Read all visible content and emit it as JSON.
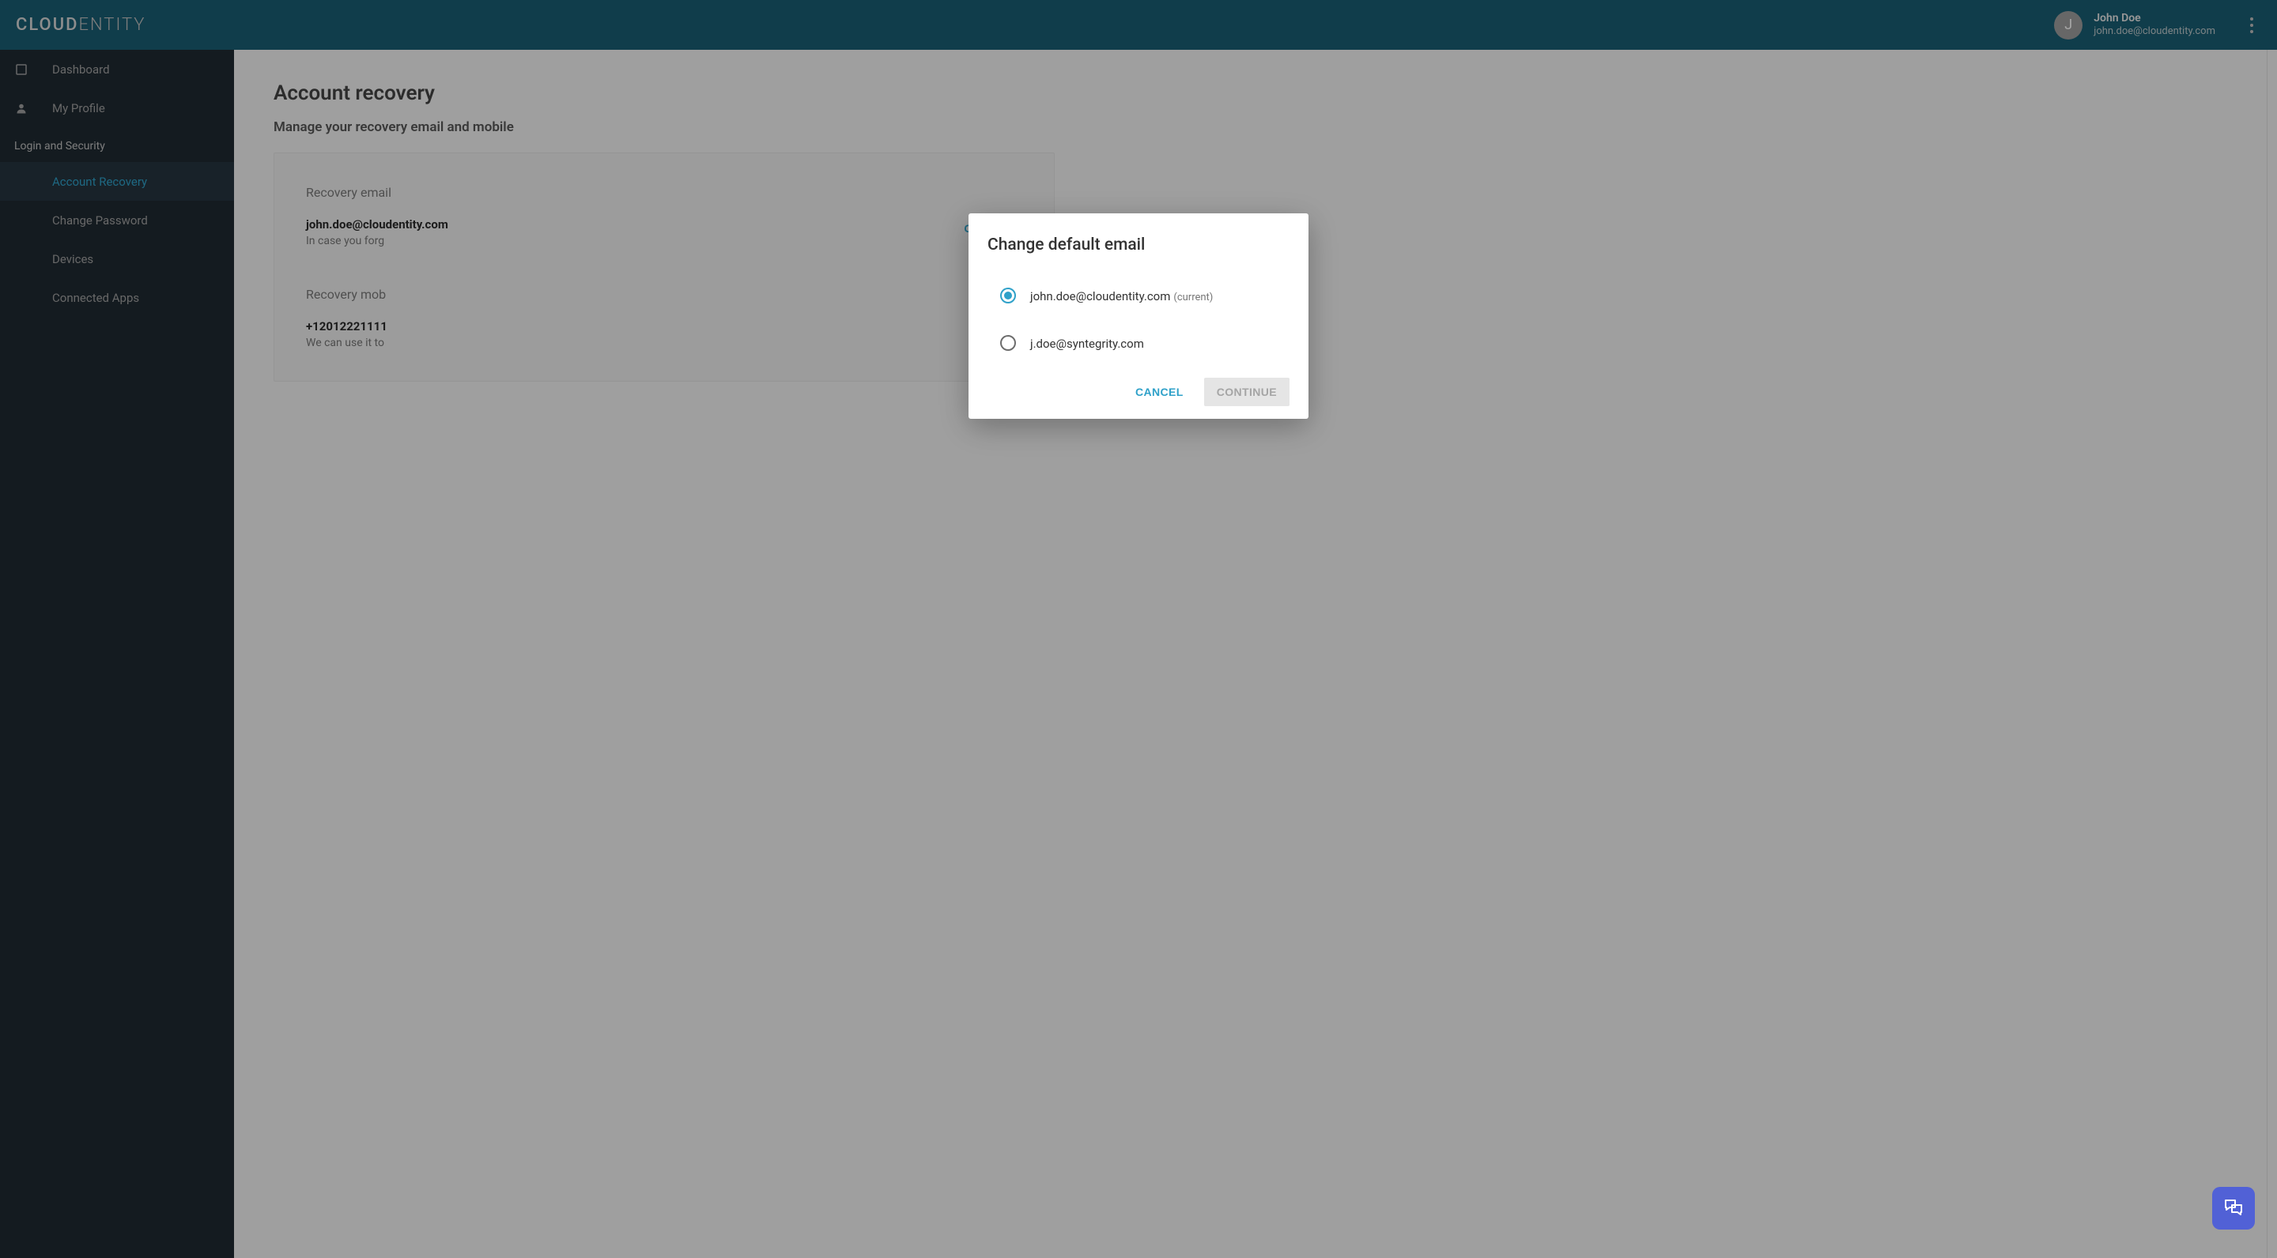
{
  "brand": {
    "part1": "CLOUD",
    "part2": "ENTITY"
  },
  "header": {
    "user_initial": "J",
    "user_name": "John Doe",
    "user_email": "john.doe@cloudentity.com"
  },
  "sidebar": {
    "items": {
      "dashboard": "Dashboard",
      "profile": "My Profile"
    },
    "section_title": "Login and Security",
    "subitems": {
      "account_recovery": "Account Recovery",
      "change_password": "Change Password",
      "devices": "Devices",
      "connected_apps": "Connected Apps"
    }
  },
  "main": {
    "title": "Account recovery",
    "subtitle": "Manage your recovery email and mobile",
    "section_email_label": "Recovery email",
    "email_value": "john.doe@cloudentity.com",
    "email_hint_partial": "In case you forg",
    "section_mobile_label": "Recovery mob",
    "mobile_value": "+12012221111",
    "mobile_hint_partial": "We can use it to",
    "change_label": "CHANGE"
  },
  "modal": {
    "title": "Change default email",
    "options": [
      {
        "label": "john.doe@cloudentity.com",
        "tag": "(current)",
        "selected": true
      },
      {
        "label": "j.doe@syntegrity.com",
        "tag": "",
        "selected": false
      }
    ],
    "cancel": "CANCEL",
    "continue": "CONTINUE"
  }
}
